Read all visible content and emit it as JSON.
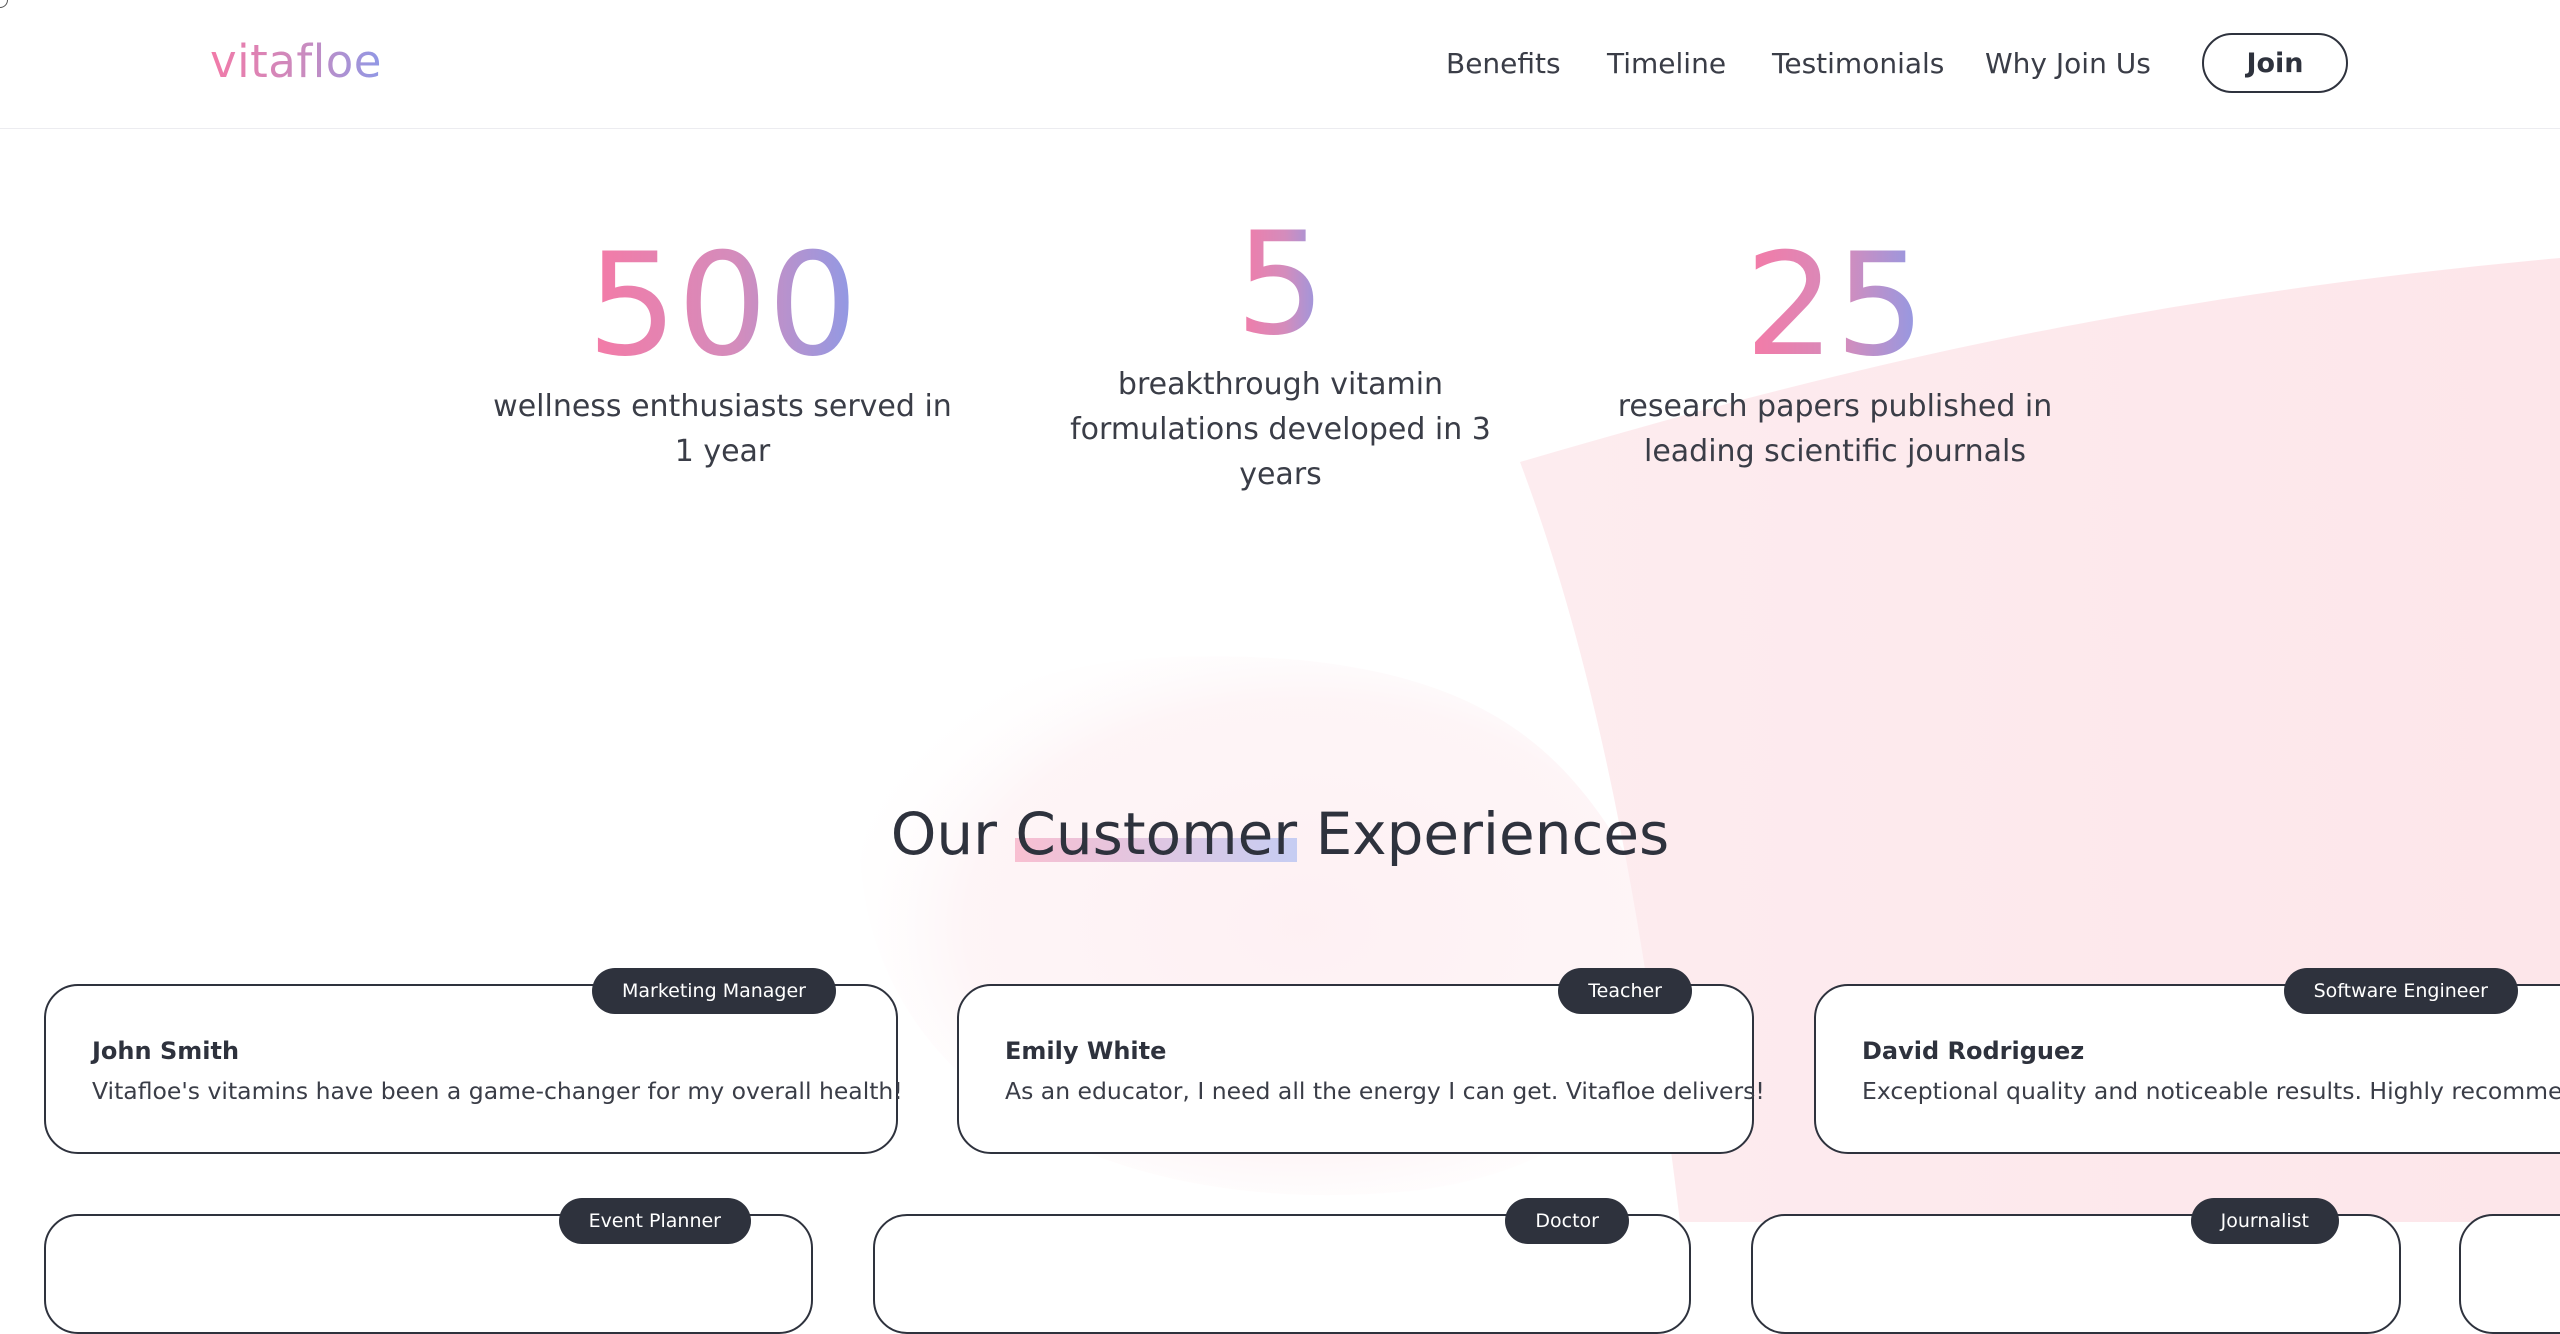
{
  "brand": {
    "logo": "vitafloe"
  },
  "nav": {
    "links": [
      "Benefits",
      "Timeline",
      "Testimonials",
      "Why Join Us"
    ],
    "join_label": "Join"
  },
  "stats": [
    {
      "number": "500",
      "text": "wellness enthusiasts served in 1 year"
    },
    {
      "number": "5",
      "text": "breakthrough vitamin formulations developed in 3 years"
    },
    {
      "number": "25",
      "text": "research papers published in leading scientific journals"
    }
  ],
  "experiences": {
    "title_before": "Our ",
    "title_highlight": "Customer",
    "title_after": " Experiences",
    "cards": [
      {
        "role": "Marketing Manager",
        "name": "John Smith",
        "quote": "Vitafloe's vitamins have been a game-changer for my overall health!"
      },
      {
        "role": "Teacher",
        "name": "Emily White",
        "quote": "As an educator, I need all the energy I can get. Vitafloe delivers!"
      },
      {
        "role": "Software Engineer",
        "name": "David Rodriguez",
        "quote": "Exceptional quality and noticeable results. Highly recommend!"
      },
      {
        "role": "Event Planner",
        "name": "",
        "quote": ""
      },
      {
        "role": "Doctor",
        "name": "",
        "quote": ""
      },
      {
        "role": "Journalist",
        "name": "",
        "quote": ""
      },
      {
        "role": "",
        "name": "",
        "quote": ""
      }
    ]
  },
  "colors": {
    "gradient_pink": "#f57aa6",
    "gradient_blue": "#8e9ae6",
    "dark": "#2e323d",
    "blob": "#fde8ec"
  }
}
